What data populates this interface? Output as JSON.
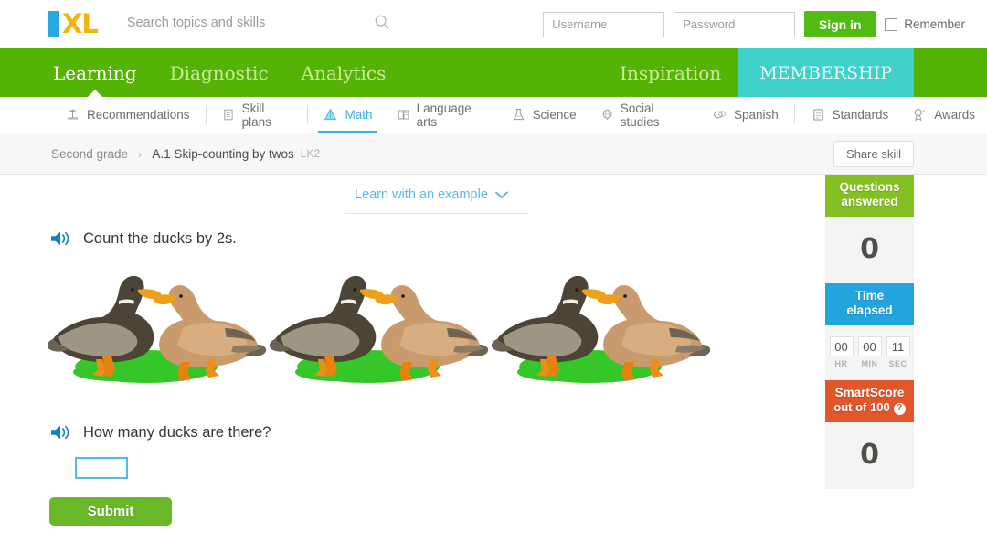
{
  "header": {
    "logo_i": "I",
    "logo_xl": "XL",
    "search": {
      "placeholder": "Search topics and skills",
      "value": "",
      "icon": "search-icon"
    },
    "login": {
      "username_placeholder": "Username",
      "username_value": "",
      "password_placeholder": "Password",
      "password_value": "",
      "signin_label": "Sign in",
      "remember_label": "Remember",
      "remember_checked": false
    }
  },
  "mainnav": {
    "left": [
      {
        "label": "Learning",
        "active": true
      },
      {
        "label": "Diagnostic",
        "active": false
      },
      {
        "label": "Analytics",
        "active": false
      }
    ],
    "right": [
      {
        "label": "Inspiration",
        "active": false,
        "highlight": false
      },
      {
        "label": "MEMBERSHIP",
        "active": false,
        "highlight": true
      }
    ],
    "bg_color": "#55b305",
    "membership_color": "#3fd0c9"
  },
  "subnav": {
    "items": [
      {
        "label": "Recommendations",
        "icon": "recommendations-icon",
        "active": false
      },
      {
        "label": "Skill plans",
        "icon": "skill-plans-icon",
        "active": false
      },
      {
        "label": "Math",
        "icon": "math-icon",
        "active": true
      },
      {
        "label": "Language arts",
        "icon": "language-arts-icon",
        "active": false
      },
      {
        "label": "Science",
        "icon": "science-flask-icon",
        "active": false
      },
      {
        "label": "Social studies",
        "icon": "globe-icon",
        "active": false
      },
      {
        "label": "Spanish",
        "icon": "spanish-icon",
        "active": false
      },
      {
        "label": "Standards",
        "icon": "clipboard-icon",
        "active": false
      },
      {
        "label": "Awards",
        "icon": "award-ribbon-icon",
        "active": false
      }
    ],
    "active_color": "#35b0e8"
  },
  "breadcrumb": {
    "grade": "Second grade",
    "separator": "›",
    "skill": "A.1 Skip-counting by twos",
    "skill_code": "LK2",
    "share_label": "Share skill"
  },
  "main": {
    "learn_link": "Learn with an example",
    "learn_chevron": "chevron-down-icon",
    "question_prompt": "Count the ducks by 2s.",
    "question_ask": "How many ducks are there?",
    "answer_value": "",
    "submit_label": "Submit",
    "duck_groups": 3,
    "ducks_per_group": 2,
    "total_ducks": 6,
    "speaker_icon": "speaker-audio-icon"
  },
  "sidebar": {
    "questions": {
      "title_line1": "Questions",
      "title_line2": "answered",
      "value": "0",
      "color": "#84c022"
    },
    "time": {
      "title_line1": "Time",
      "title_line2": "elapsed",
      "color": "#22a4dd",
      "hours": "00",
      "minutes": "00",
      "seconds": "11",
      "hours_label": "HR",
      "minutes_label": "MIN",
      "seconds_label": "SEC"
    },
    "smartscore": {
      "title": "SmartScore",
      "subtitle": "out of 100",
      "help": "?",
      "value": "0",
      "color": "#e2562a"
    }
  }
}
